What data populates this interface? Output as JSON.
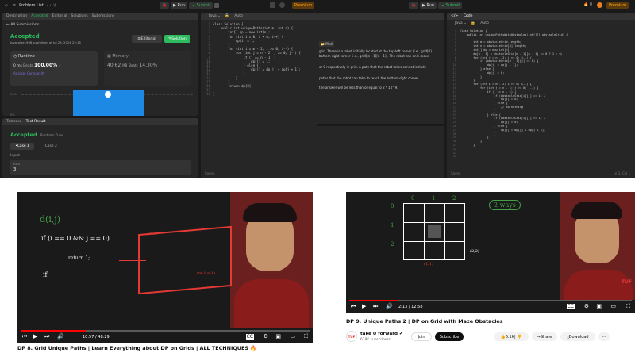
{
  "tl": {
    "problem_list": "Problem List",
    "run": "Run",
    "submit": "Submit",
    "premium": "Premium",
    "tabs": [
      "Description",
      "Accepted",
      "Editorial",
      "Solutions",
      "Submissions"
    ],
    "all_submissions": "All Submissions",
    "accepted": "Accepted",
    "submitted_by": "luvprolee1998 submitted at Jul 23, 2024 22:15",
    "editorial_btn": "Editorial",
    "solution_btn": "Solution",
    "runtime_label": "Runtime",
    "runtime_val": "0 ms",
    "beats": "Beats",
    "beats_val": "100.00%",
    "analyze": "Analyze Complexity",
    "memory_label": "Memory",
    "memory_val": "40.62",
    "memory_unit": "MB",
    "memory_beats": "Beats",
    "memory_beats_val": "14.30%",
    "pct_top": "50%",
    "pct_bot": "0%",
    "java": "Java",
    "auto": "Auto",
    "code": "class Solution {\n    public int uniquePaths(int m, int n) {\n        int[] dp = new int[n];\n        for (int i = 0; i < n; i++) {\n            dp[i] = 1;\n        }\n        for (int i = m - 2; i >= 0; i--) {\n            for (int j = n - 2; j >= 0; j--) {\n                if (j == n - 1) {\n                    dp[j] = 1;\n                } else {\n                    dp[j] = dp[j] + dp[j + 1];\n                }\n            }\n        }\n        return dp[0];\n    }\n}",
    "testcase": "Testcase",
    "test_result": "Test Result",
    "tr_accepted": "Accepted",
    "tr_runtime": "Runtime: 0 ms",
    "case1": "Case 1",
    "case2": "Case 2",
    "input": "Input",
    "m_label": "m =",
    "m_val": "3",
    "saved": "Saved"
  },
  "tr": {
    "run": "Run",
    "submit": "Submit",
    "premium": "Premium",
    "streak": "0",
    "desc_tab": "Code",
    "java": "Java",
    "auto": "Auto",
    "saved": "Saved",
    "desc1": "grid. There is a robot initially located at the top-left corner (i.e., grid[0]",
    "desc2": "bottom-right corner (i.e., grid[m - 1][n - 1]). The robot can only move",
    "desc3": "or 0 respectively in grid. A path that the robot takes cannot include",
    "desc4": "paths that the robot can take to reach the bottom-right corner.",
    "desc5": "the answer will be less than or equal to 2 * 10^9.",
    "med": "Med",
    "position": "Ln 1, Col 1",
    "code": "class Solution {\n    public int uniquePathsWithObstacles(int[][] obstacleGrid) {\n\n        int m = obstacleGrid.length;\n        int n = obstacleGrid[0].length;\n        int[] dp = new int[n];\n        dp[n - 1] = obstacleGrid[m - 1][n - 1] == 0 ? 1 : 0;\n        for (int j = n - 2; j >= 0; j--) {\n            if (obstacleGrid[m - 1][j] == 0) {\n                dp[j] = dp[j + 1];\n            } else {\n                dp[j] = 0;\n            }\n        }\n        for (int i = m - 2; i >= 0; i--) {\n            for (int j = n - 1; j >= 0; j--) {\n                if (j == n - 1) {\n                    if (obstacleGrid[i][j] == 1) {\n                        dp[j] = 0;\n                    } else {\n                        // do nothing\n                    }\n                } else {\n                    if (obstacleGrid[i][j] == 1) {\n                        dp[j] = 0;\n                    } else {\n                        dp[j] = dp[j] + dp[j + 1];\n                    }\n                }\n            }\n        }"
  },
  "bl": {
    "time": "10:57 / 48:29",
    "progress": 0.226,
    "title": "DP 8. Grid Unique Paths | Learn Everything about DP on Grids | ALL TECHNIQUES 🔥",
    "hw1": "d(i,j)",
    "hw2": "if (i == 0 && j == 0)",
    "hw3": "return 1;",
    "hw4": "if",
    "hw5": "(0,0)",
    "hw6": "(m-1,n-1)"
  },
  "br": {
    "time": "2:13 / 12:58",
    "progress": 0.171,
    "title": "DP 9. Unique Paths 2 | DP on Grid with Maze Obstacles",
    "channel": "take U forward",
    "subs": "619K subscribers",
    "join": "Join",
    "subscribe": "Subscribe",
    "likes": "6.1K",
    "share": "Share",
    "download": "Download",
    "ways": "2 ways",
    "logo": "TUF",
    "grid_rows": [
      "0",
      "1",
      "2"
    ],
    "grid_cols": [
      "0",
      "1",
      "2"
    ],
    "rc1": "(1,1)",
    "rc2": "(2,2)"
  }
}
